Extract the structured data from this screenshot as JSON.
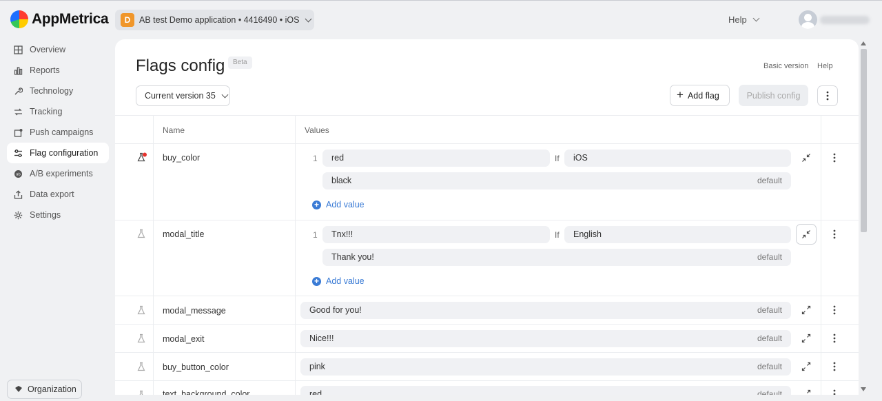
{
  "app": {
    "name": "AppMetrica"
  },
  "header": {
    "app_badge": "D",
    "app_selector": "AB test Demo application  •  4416490  •  iOS",
    "help": "Help"
  },
  "sidebar": {
    "items": [
      {
        "label": "Overview",
        "icon": "grid-icon"
      },
      {
        "label": "Reports",
        "icon": "bar-chart-icon"
      },
      {
        "label": "Technology",
        "icon": "wrench-icon"
      },
      {
        "label": "Tracking",
        "icon": "tracking-icon"
      },
      {
        "label": "Push campaigns",
        "icon": "push-icon"
      },
      {
        "label": "Flag configuration",
        "icon": "sliders-icon",
        "active": true
      },
      {
        "label": "A/B experiments",
        "icon": "ab-icon"
      },
      {
        "label": "Data export",
        "icon": "export-icon"
      },
      {
        "label": "Settings",
        "icon": "gear-icon"
      }
    ],
    "organization": "Organization"
  },
  "page": {
    "title": "Flags config",
    "beta": "Beta",
    "basic_version": "Basic version",
    "help": "Help",
    "version_select": "Current version 35",
    "add_flag": "Add flag",
    "publish": "Publish config"
  },
  "table": {
    "col_name": "Name",
    "col_values": "Values",
    "if_label": "If",
    "default_label": "default",
    "add_value": "Add value",
    "flags": [
      {
        "name": "buy_color",
        "condition_value": "red",
        "condition_index": "1",
        "condition": "iOS",
        "default_value": "black"
      },
      {
        "name": "modal_title",
        "condition_value": "Tnx!!!",
        "condition_index": "1",
        "condition": "English",
        "default_value": "Thank you!"
      },
      {
        "name": "modal_message",
        "value": "Good for you!"
      },
      {
        "name": "modal_exit",
        "value": "Nice!!!"
      },
      {
        "name": "buy_button_color",
        "value": "pink"
      },
      {
        "name": "text_background_color",
        "value": "red"
      }
    ]
  },
  "colors": {
    "accent": "#3a7bd5",
    "badge": "#f0962a",
    "alert": "#e5322d"
  }
}
